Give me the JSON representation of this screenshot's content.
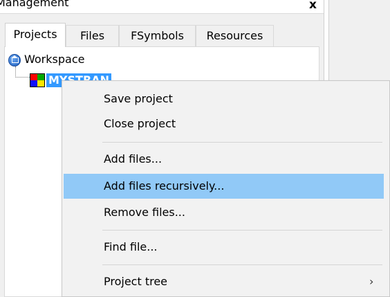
{
  "panel": {
    "title": "Management",
    "close_glyph": "x",
    "tabs": [
      {
        "label": "Projects",
        "active": true
      },
      {
        "label": "Files",
        "active": false
      },
      {
        "label": "FSymbols",
        "active": false
      },
      {
        "label": "Resources",
        "active": false
      }
    ]
  },
  "tree": {
    "root": {
      "label": "Workspace",
      "icon": "workspace-home-icon"
    },
    "project": {
      "label": "MYSTRAN",
      "icon": "project-colored-squares-icon",
      "selected": true
    }
  },
  "context_menu": {
    "items": [
      {
        "label": "Save project"
      },
      {
        "label": "Close project"
      },
      {
        "label": "Add files..."
      },
      {
        "label": "Add files recursively...",
        "highlighted": true
      },
      {
        "label": "Remove files..."
      },
      {
        "label": "Find file..."
      },
      {
        "label": "Project tree",
        "submenu_glyph": "›"
      }
    ]
  },
  "colors": {
    "selection": "#3399ff",
    "menu_highlight": "#91c9f7",
    "menu_bg": "#f2f2f2",
    "panel_bg": "#f0f0f0"
  }
}
